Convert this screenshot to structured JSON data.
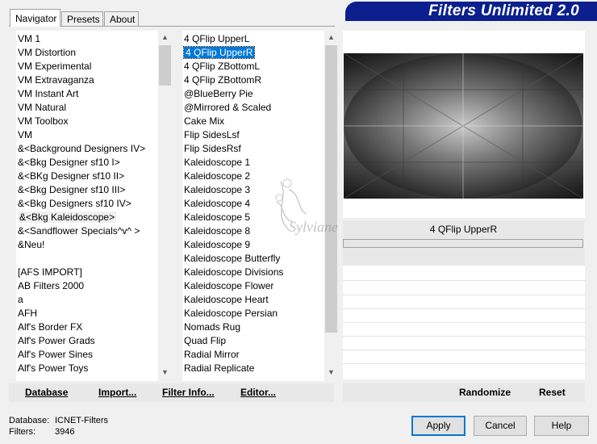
{
  "window": {
    "title": "Filters Unlimited 2.0"
  },
  "tabs": [
    {
      "label": "Navigator",
      "active": true
    },
    {
      "label": "Presets",
      "active": false
    },
    {
      "label": "About",
      "active": false
    }
  ],
  "categories": {
    "items": [
      "VM 1",
      "VM Distortion",
      "VM Experimental",
      "VM Extravaganza",
      "VM Instant Art",
      "VM Natural",
      "VM Toolbox",
      "VM",
      "&<Background Designers IV>",
      "&<Bkg Designer sf10 I>",
      "&<BKg Designer sf10 II>",
      "&<Bkg Designer sf10 III>",
      "&<Bkg Designers sf10 IV>",
      "&<Bkg Kaleidoscope>",
      "&<Sandflower Specials^v^ >",
      "&Neu!",
      "",
      "[AFS IMPORT]",
      "AB Filters 2000",
      "a",
      "AFH",
      "Alf's Border FX",
      "Alf's Power Grads",
      "Alf's Power Sines",
      "Alf's Power Toys"
    ],
    "highlighted": "&<Bkg Kaleidoscope>"
  },
  "filters": {
    "items": [
      "4 QFlip UpperL",
      "4 QFlip UpperR",
      "4 QFlip ZBottomL",
      "4 QFlip ZBottomR",
      "@BlueBerry Pie",
      "@Mirrored & Scaled",
      "Cake Mix",
      "Flip SidesLsf",
      "Flip SidesRsf",
      "Kaleidoscope 1",
      "Kaleidoscope 2",
      "Kaleidoscope 3",
      "Kaleidoscope 4",
      "Kaleidoscope 5",
      "Kaleidoscope 8",
      "Kaleidoscope 9",
      "Kaleidoscope Butterfly",
      "Kaleidoscope Divisions",
      "Kaleidoscope Flower",
      "Kaleidoscope Heart",
      "Kaleidoscope Persian",
      "Nomads Rug",
      "Quad Flip",
      "Radial Mirror",
      "Radial Replicate"
    ],
    "selected": "4 QFlip UpperR"
  },
  "preview": {
    "filter_name": "4 QFlip UpperR",
    "watermark": "Sylviane"
  },
  "toolbar": {
    "database_label": "Database",
    "import_label": "Import...",
    "filter_info_label": "Filter Info...",
    "editor_label": "Editor...",
    "randomize_label": "Randomize",
    "reset_label": "Reset"
  },
  "status": {
    "database_label": "Database:",
    "database_value": "ICNET-Filters",
    "filters_label": "Filters:",
    "filters_value": "3946"
  },
  "buttons": {
    "apply": "Apply",
    "cancel": "Cancel",
    "help": "Help"
  },
  "colors": {
    "banner": "#0b1f8f",
    "selection": "#0078d7"
  }
}
